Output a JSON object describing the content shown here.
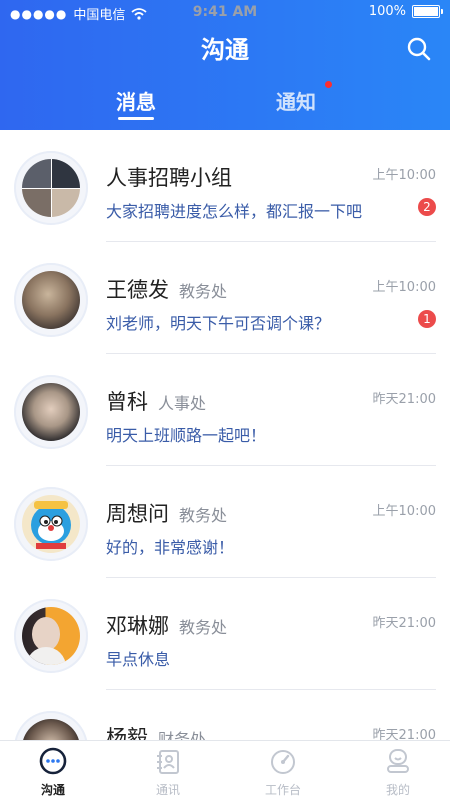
{
  "status_bar": {
    "carrier": "中国电信",
    "time": "9:41 AM",
    "battery": "100%"
  },
  "header": {
    "title": "沟通",
    "tabs": [
      {
        "label": "消息",
        "active": true
      },
      {
        "label": "通知",
        "active": false,
        "has_unread_dot": true
      }
    ]
  },
  "conversations": [
    {
      "name": "人事招聘小组",
      "department": "",
      "message": "大家招聘进度怎么样，都汇报一下吧",
      "time": "上午10:00",
      "unread": "2"
    },
    {
      "name": "王德发",
      "department": "教务处",
      "message": "刘老师，明天下午可否调个课？",
      "time": "上午10:00",
      "unread": "1"
    },
    {
      "name": "曾科",
      "department": "人事处",
      "message": "明天上班顺路一起吧！",
      "time": "昨天21:00",
      "unread": ""
    },
    {
      "name": "周想问",
      "department": "教务处",
      "message": "好的，非常感谢！",
      "time": "上午10:00",
      "unread": ""
    },
    {
      "name": "邓琳娜",
      "department": "教务处",
      "message": "早点休息",
      "time": "昨天21:00",
      "unread": ""
    },
    {
      "name": "杨毅",
      "department": "财务处",
      "message": "",
      "time": "昨天21:00",
      "unread": ""
    }
  ],
  "tab_bar": [
    {
      "label": "沟通",
      "icon": "chat-bubble-icon",
      "active": true
    },
    {
      "label": "通讯",
      "icon": "contacts-icon",
      "active": false
    },
    {
      "label": "工作台",
      "icon": "dashboard-gauge-icon",
      "active": false
    },
    {
      "label": "我的",
      "icon": "profile-icon",
      "active": false
    }
  ],
  "colors": {
    "header_start": "#2f67f0",
    "header_end": "#2a86f7",
    "message_text": "#3a5ca8",
    "badge": "#ec4b4b"
  }
}
